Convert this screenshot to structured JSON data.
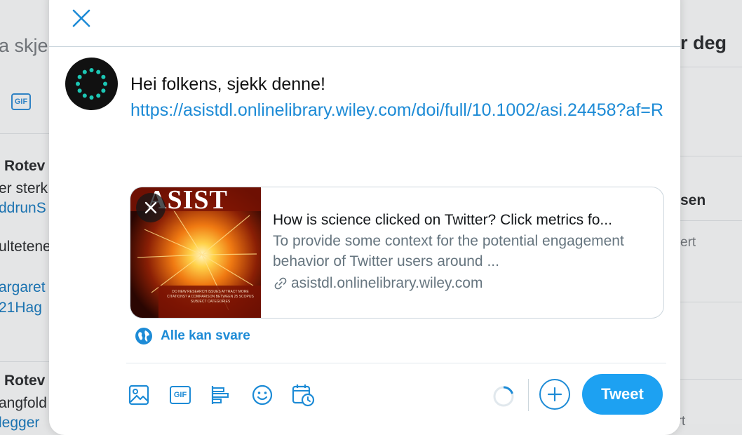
{
  "background": {
    "search_fragment": "a skje",
    "right_heading_fragment": "r deg",
    "gif_label": "GIF",
    "tweet1": {
      "name_fragment": "Rotev",
      "line1": "er sterk",
      "line2": "ddrunS",
      "line3": "ultetene",
      "line4": "argaret",
      "line5": "21Hag"
    },
    "tweet2": {
      "name_fragment": "Rotev",
      "line1": "angfold",
      "line2": "legger"
    },
    "right_item_fragment": "sen",
    "right_muted1": "ert",
    "right_muted2": "ert"
  },
  "modal": {
    "close_icon": "close-icon",
    "compose": {
      "text": "Hei folkens, sjekk denne!",
      "link": "https://asistdl.onlinelibrary.wiley.com/doi/full/10.1002/asi.24458?af=R"
    },
    "card": {
      "title": "How is science clicked on Twitter? Click metrics fo...",
      "description": "To provide some context for the potential engagement behavior of Twitter users around ...",
      "domain": "asistdl.onlinelibrary.wiley.com",
      "thumb_masthead": "ASIST",
      "thumb_caption": "DO NEW RESEARCH ISSUES ATTRACT MORE CITATIONS? A COMPARISON BETWEEN 25 SCOPUS SUBJECT CATEGORIES"
    },
    "reply_setting": "Alle kan svare",
    "toolbar": {
      "gif_label": "GIF",
      "icons": [
        "image-icon",
        "gif-icon",
        "poll-icon",
        "emoji-icon",
        "schedule-icon"
      ]
    },
    "tweet_button": "Tweet",
    "colors": {
      "accent": "#1d8bd6",
      "tweet_button": "#1da1f2"
    }
  }
}
